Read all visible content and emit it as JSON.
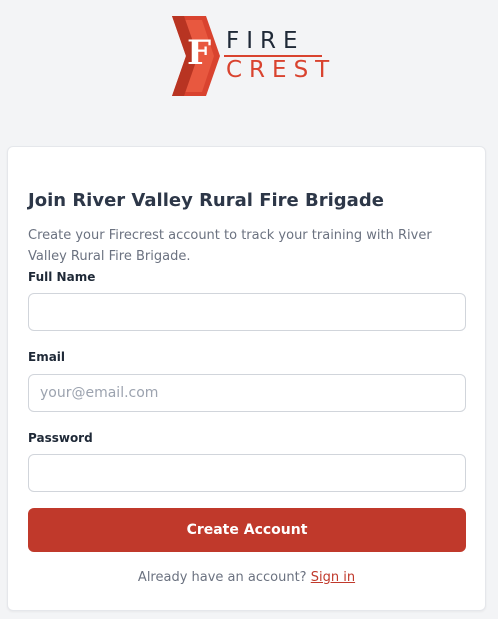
{
  "brand": {
    "monogram": "F",
    "word_top": "FIRE",
    "word_bottom": "CREST",
    "colors": {
      "primary": "#d9432f",
      "dark": "#1f2937"
    }
  },
  "form": {
    "title": "Join River Valley Rural Fire Brigade",
    "subtitle": "Create your Firecrest account to track your training with River Valley Rural Fire Brigade.",
    "fields": {
      "full_name": {
        "label": "Full Name",
        "value": "",
        "placeholder": ""
      },
      "email": {
        "label": "Email",
        "value": "",
        "placeholder": "your@email.com"
      },
      "password": {
        "label": "Password",
        "value": "",
        "placeholder": ""
      }
    },
    "submit_label": "Create Account",
    "signin_prompt": "Already have an account?",
    "signin_link": "Sign in"
  },
  "theme": {
    "button_color": "#c0392b",
    "background": "#f3f4f6"
  }
}
